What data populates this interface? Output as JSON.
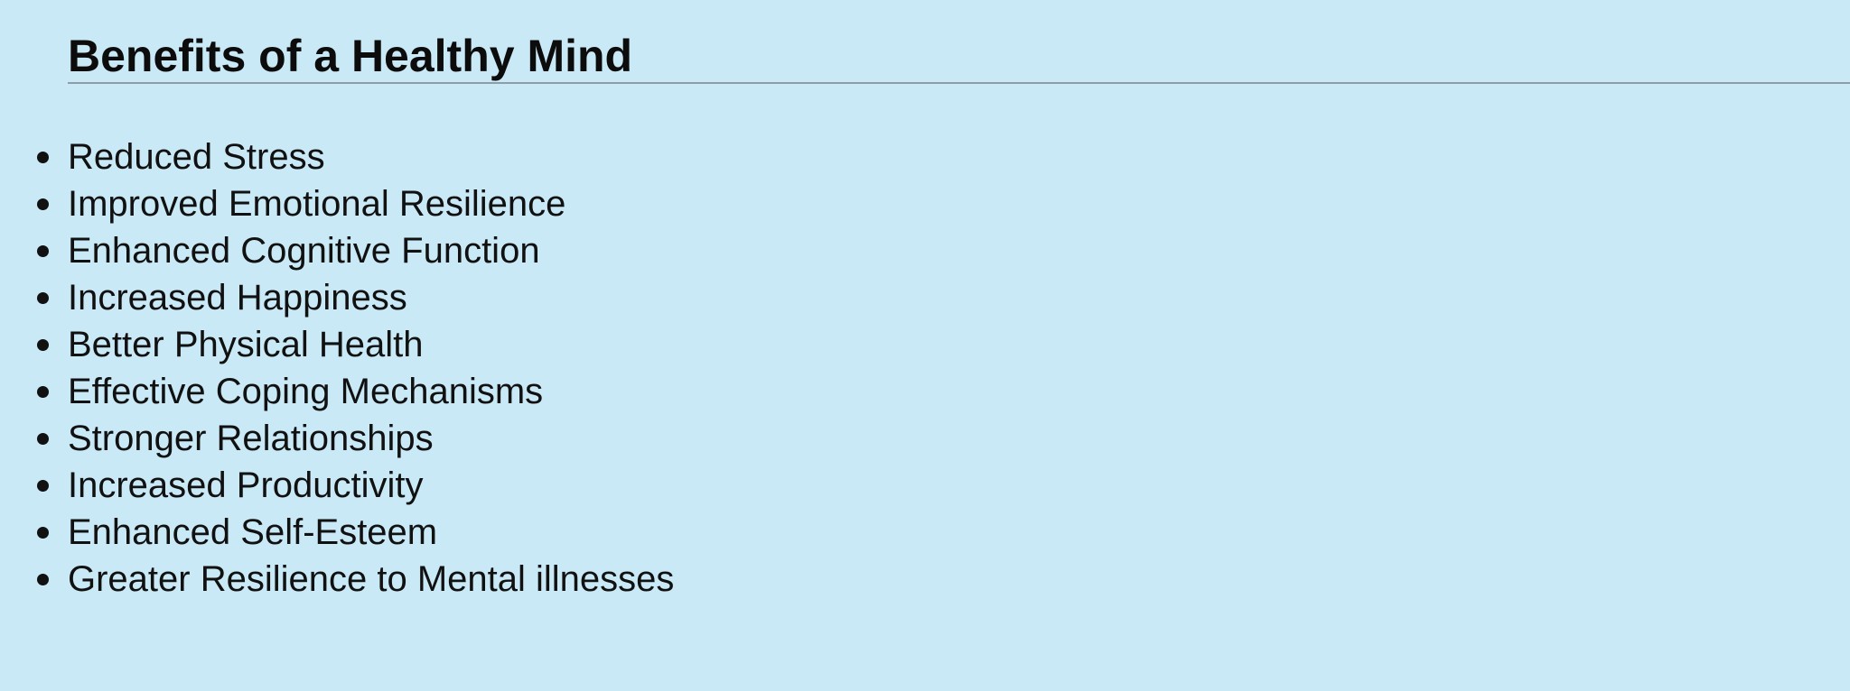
{
  "page": {
    "title": "Benefits of a Healthy Mind",
    "background_color": "#c9e9f6",
    "text_color": "#111111"
  },
  "benefits": {
    "items": [
      "Reduced Stress",
      "Improved Emotional Resilience",
      "Enhanced Cognitive Function",
      "Increased Happiness",
      "Better Physical Health",
      "Effective Coping Mechanisms",
      "Stronger Relationships",
      "Increased Productivity",
      "Enhanced Self-Esteem",
      "Greater Resilience to Mental illnesses"
    ]
  }
}
